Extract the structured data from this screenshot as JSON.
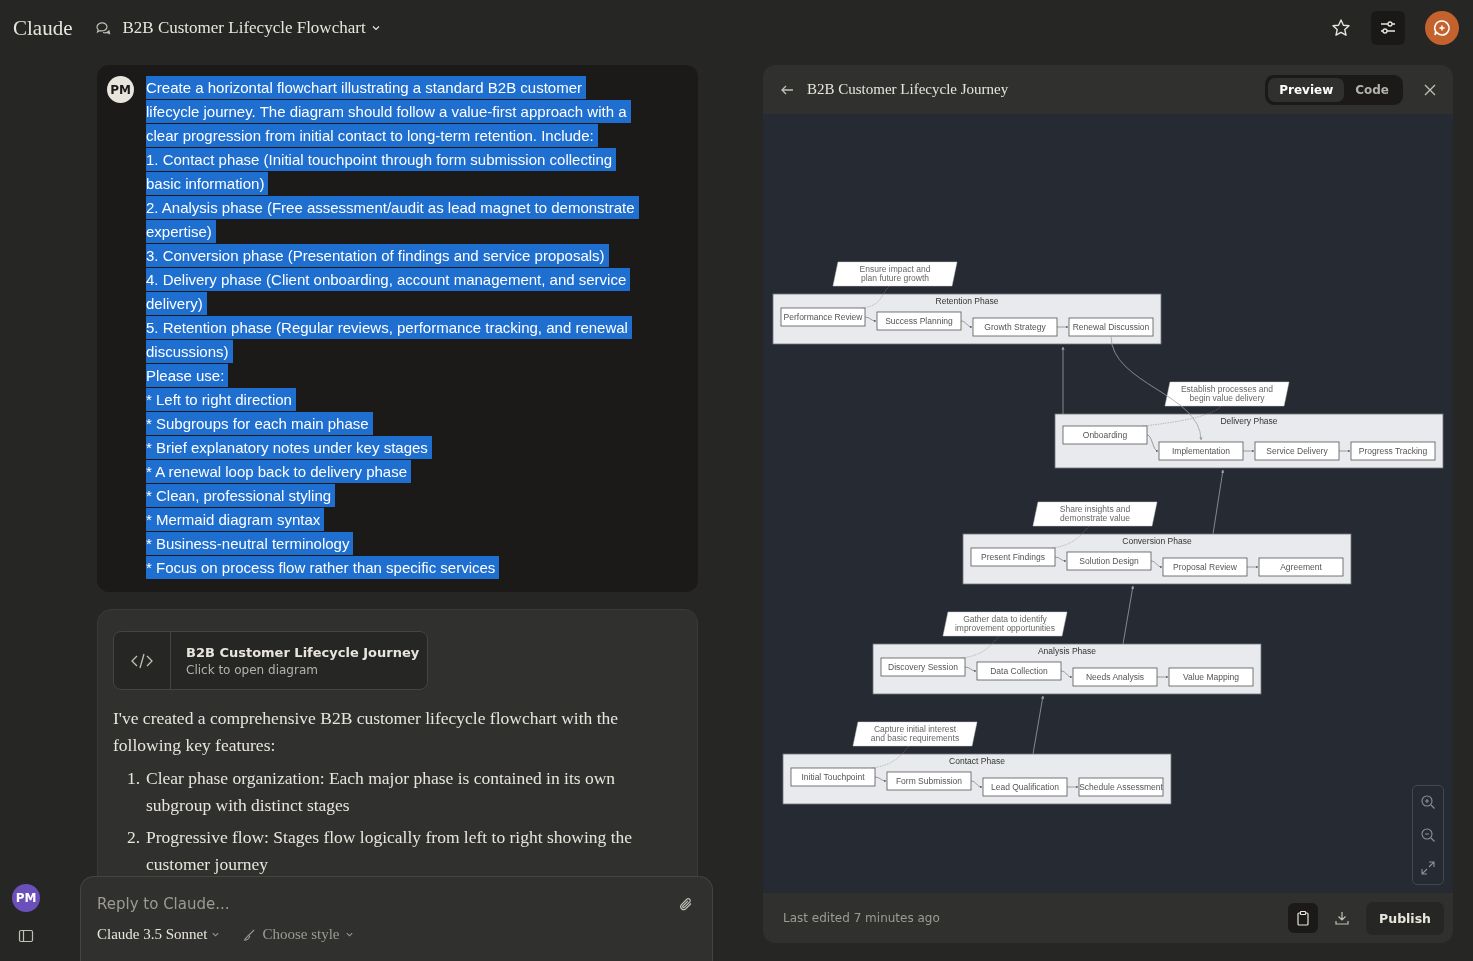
{
  "header": {
    "logo": "Claude",
    "chat_title": "B2B Customer Lifecycle Flowchart"
  },
  "user_message": {
    "avatar": "PM",
    "highlighted": true,
    "lines": [
      "Create a horizontal flowchart illustrating a standard B2B customer",
      "lifecycle journey. The diagram should follow a value-first approach with a",
      "clear progression from initial contact to long-term retention. Include:",
      "1. Contact phase (Initial touchpoint through form submission collecting",
      "basic information)",
      "2. Analysis phase (Free assessment/audit as lead magnet to demonstrate",
      "expertise)",
      "3. Conversion phase (Presentation of findings and service proposals)",
      "4. Delivery phase (Client onboarding, account management, and service",
      "delivery)",
      "5. Retention phase (Regular reviews, performance tracking, and renewal",
      "discussions)",
      "Please use:",
      "* Left to right direction",
      "* Subgroups for each main phase",
      "* Brief explanatory notes under key stages",
      "* A renewal loop back to delivery phase",
      "* Clean, professional styling",
      "* Mermaid diagram syntax",
      "* Business-neutral terminology",
      "* Focus on process flow rather than specific services"
    ]
  },
  "assistant_message": {
    "artifact": {
      "title": "B2B Customer Lifecycle Journey",
      "subtitle": "Click to open diagram"
    },
    "intro": "I've created a comprehensive B2B customer lifecycle flowchart with the following key features:",
    "items": [
      {
        "number": "1.",
        "text": "Clear phase organization: Each major phase is contained in its own subgroup with distinct stages"
      },
      {
        "number": "2.",
        "text": "Progressive flow: Stages flow logically from left to right showing the customer journey"
      }
    ]
  },
  "reply_box": {
    "placeholder": "Reply to Claude...",
    "model": "Claude 3.5 Sonnet",
    "style": "Choose style"
  },
  "sidebar": {
    "avatar": "PM"
  },
  "artifact_panel": {
    "title": "B2B Customer Lifecycle Journey",
    "tabs": [
      {
        "label": "Preview",
        "selected": true
      },
      {
        "label": "Code",
        "selected": false
      }
    ],
    "diagram": {
      "groups": [
        {
          "title": "Retention Phase",
          "nodes": [
            "Performance Review",
            "Success Planning",
            "Growth Strategy",
            "Renewal Discussion"
          ],
          "note": [
            "Ensure impact and",
            "plan future growth"
          ]
        },
        {
          "title": "Delivery Phase",
          "nodes": [
            "Onboarding",
            "Implementation",
            "Service Delivery",
            "Progress Tracking"
          ],
          "note": [
            "Establish processes and",
            "begin value delivery"
          ]
        },
        {
          "title": "Conversion Phase",
          "nodes": [
            "Present Findings",
            "Solution Design",
            "Proposal Review",
            "Agreement"
          ],
          "note": [
            "Share insights and",
            "demonstrate value"
          ]
        },
        {
          "title": "Analysis Phase",
          "nodes": [
            "Discovery Session",
            "Data Collection",
            "Needs Analysis",
            "Value Mapping"
          ],
          "note": [
            "Gather data to identify",
            "improvement opportunities"
          ]
        },
        {
          "title": "Contact Phase",
          "nodes": [
            "Initial Touchpoint",
            "Form Submission",
            "Lead Qualification",
            "Schedule Assessment"
          ],
          "note": [
            "Capture initial interest",
            "and basic requirements"
          ]
        }
      ]
    },
    "footer": {
      "last_edited": "Last edited 7 minutes ago",
      "publish": "Publish"
    }
  }
}
